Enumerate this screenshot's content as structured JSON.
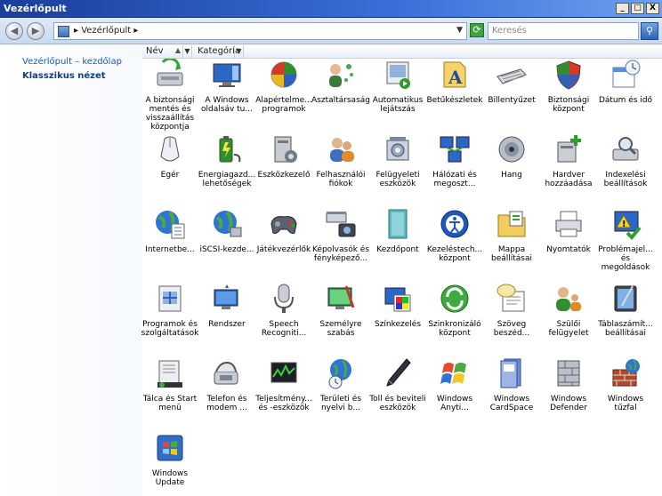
{
  "window": {
    "title": "Vezérlőpult",
    "controls": [
      "_",
      "□",
      "X"
    ]
  },
  "address": {
    "crumb": "Vezérlőpult",
    "search_placeholder": "Keresés"
  },
  "sidebar": {
    "home_link": "Vezérlőpult – kezdőlap",
    "classic_view": "Klasszikus nézet"
  },
  "columns": [
    {
      "label": "Név"
    },
    {
      "label": "Kategória"
    }
  ],
  "items": [
    {
      "label": "A biztonsági mentés és visszaállítás központja",
      "icon": "backup-icon"
    },
    {
      "label": "A Windows oldalsáv tu...",
      "icon": "sidebar-icon"
    },
    {
      "label": "Alapértelme... programok",
      "icon": "default-programs-icon"
    },
    {
      "label": "Asztaltársaság",
      "icon": "people-near-me-icon"
    },
    {
      "label": "Automatikus lejátszás",
      "icon": "autoplay-icon"
    },
    {
      "label": "Betűkészletek",
      "icon": "fonts-icon"
    },
    {
      "label": "Billentyűzet",
      "icon": "keyboard-icon"
    },
    {
      "label": "Biztonsági központ",
      "icon": "security-center-icon"
    },
    {
      "label": "Dátum és idő",
      "icon": "date-time-icon"
    },
    {
      "label": "Egér",
      "icon": "mouse-icon"
    },
    {
      "label": "Energiagazd... lehetőségek",
      "icon": "power-options-icon"
    },
    {
      "label": "Eszközkezelő",
      "icon": "device-manager-icon"
    },
    {
      "label": "Felhasználói fiókok",
      "icon": "user-accounts-icon"
    },
    {
      "label": "Felügyeleti eszközök",
      "icon": "admin-tools-icon"
    },
    {
      "label": "Hálózati és megoszt...",
      "icon": "network-sharing-icon"
    },
    {
      "label": "Hang",
      "icon": "sound-icon"
    },
    {
      "label": "Hardver hozzáadása",
      "icon": "add-hardware-icon"
    },
    {
      "label": "Indexelési beállítások",
      "icon": "indexing-icon"
    },
    {
      "label": "Internetbe...",
      "icon": "internet-options-icon"
    },
    {
      "label": "iSCSI-kezde...",
      "icon": "iscsi-icon"
    },
    {
      "label": "Játékvezérlők",
      "icon": "game-controllers-icon"
    },
    {
      "label": "Képolvasók és fényképező...",
      "icon": "scanners-cameras-icon"
    },
    {
      "label": "Kezdőpont",
      "icon": "welcome-center-icon"
    },
    {
      "label": "Kezeléstech... központ",
      "icon": "ease-of-access-icon"
    },
    {
      "label": "Mappa beállításai",
      "icon": "folder-options-icon"
    },
    {
      "label": "Nyomtatók",
      "icon": "printers-icon"
    },
    {
      "label": "Problémajel... és megoldások",
      "icon": "problem-reports-icon"
    },
    {
      "label": "Programok és szolgáltatások",
      "icon": "programs-features-icon"
    },
    {
      "label": "Rendszer",
      "icon": "system-icon"
    },
    {
      "label": "Speech Recogniti...",
      "icon": "speech-recognition-icon"
    },
    {
      "label": "Személyre szabás",
      "icon": "personalization-icon"
    },
    {
      "label": "Színkezelés",
      "icon": "color-management-icon"
    },
    {
      "label": "Szinkronizáló központ",
      "icon": "sync-center-icon"
    },
    {
      "label": "Szöveg beszéd...",
      "icon": "text-to-speech-icon"
    },
    {
      "label": "Szülői felügyelet",
      "icon": "parental-controls-icon"
    },
    {
      "label": "Táblaszámít... beállításai",
      "icon": "tablet-pc-icon"
    },
    {
      "label": "Tálca és Start menü",
      "icon": "taskbar-start-icon"
    },
    {
      "label": "Telefon és modem ...",
      "icon": "phone-modem-icon"
    },
    {
      "label": "Teljesítmény... és -eszközök",
      "icon": "performance-icon"
    },
    {
      "label": "Területi és nyelvi b...",
      "icon": "regional-language-icon"
    },
    {
      "label": "Toll és beviteli eszközök",
      "icon": "pen-input-icon"
    },
    {
      "label": "Windows Anyti...",
      "icon": "windows-anytime-icon"
    },
    {
      "label": "Windows CardSpace",
      "icon": "cardspace-icon"
    },
    {
      "label": "Windows Defender",
      "icon": "defender-icon"
    },
    {
      "label": "Windows tűzfal",
      "icon": "firewall-icon"
    },
    {
      "label": "Windows Update",
      "icon": "windows-update-icon"
    }
  ]
}
